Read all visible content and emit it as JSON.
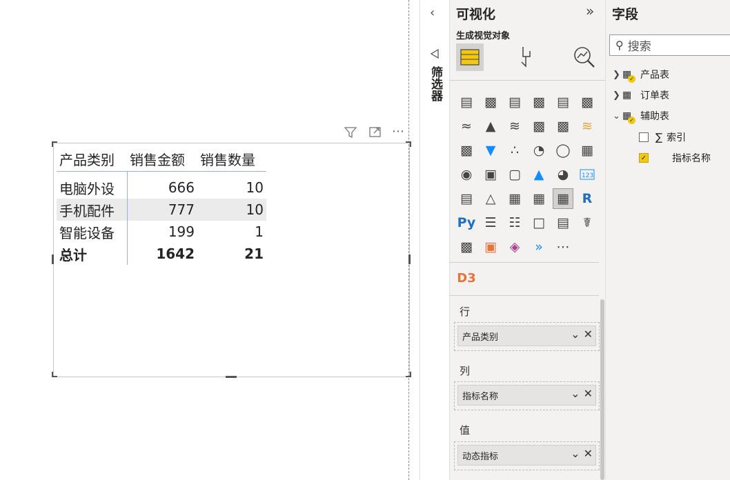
{
  "matrix": {
    "headers": [
      "产品类别",
      "销售金额",
      "销售数量"
    ],
    "rows": [
      {
        "category": "电脑外设",
        "amount": "666",
        "qty": "10"
      },
      {
        "category": "手机配件",
        "amount": "777",
        "qty": "10"
      },
      {
        "category": "智能设备",
        "amount": "199",
        "qty": "1"
      }
    ],
    "total": {
      "label": "总计",
      "amount": "1642",
      "qty": "21"
    }
  },
  "visual_header_icons": {
    "filter": "funnel-icon",
    "focus": "focus-mode-icon",
    "more": "⋯"
  },
  "filter_pane": {
    "title": "筛选器"
  },
  "viz_pane": {
    "title": "可视化",
    "subtitle": "生成视觉对象",
    "more_visuals": "⋯",
    "wells": [
      {
        "label": "行",
        "field": "产品类别"
      },
      {
        "label": "列",
        "field": "指标名称"
      },
      {
        "label": "值",
        "field": "动态指标"
      }
    ]
  },
  "fields_pane": {
    "title": "字段",
    "search_placeholder": "搜索",
    "tables": [
      {
        "name": "产品表"
      },
      {
        "name": "订单表"
      },
      {
        "name": "辅助表"
      }
    ],
    "fields": [
      {
        "name": "索引",
        "checked": false
      },
      {
        "name": "指标名称",
        "checked": true
      }
    ]
  },
  "colors": {
    "accent": "#f2c811",
    "selection": "#e1dfdd",
    "divider": "#8ab4e6"
  }
}
